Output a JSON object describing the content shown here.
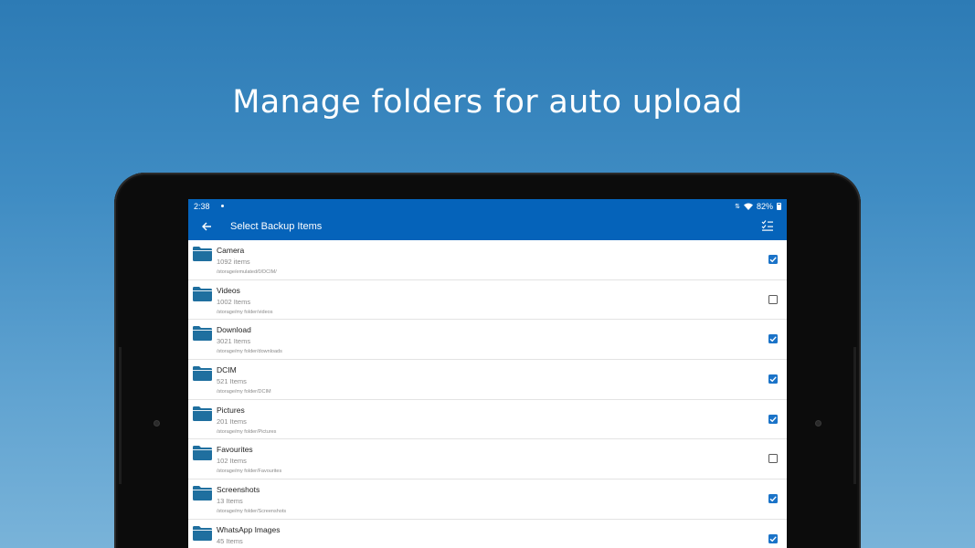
{
  "headline": "Manage folders for auto upload",
  "status_bar": {
    "time": "2:38",
    "battery": "82%"
  },
  "app_bar": {
    "title": "Select Backup Items"
  },
  "colors": {
    "primary": "#0563ba",
    "folder": "#1f6f9f",
    "checkbox_checked": "#1a73c8"
  },
  "items": [
    {
      "name": "Camera",
      "count": "1092 items",
      "path": "/storage/emulated/0/DCIM/",
      "checked": true
    },
    {
      "name": "Videos",
      "count": "1002 Items",
      "path": "/storage/my folder/videos",
      "checked": false
    },
    {
      "name": "Download",
      "count": "3021 Items",
      "path": "/storage/my folder/downloads",
      "checked": true
    },
    {
      "name": "DCIM",
      "count": "521 Items",
      "path": "/storage/my folder/DCIM",
      "checked": true
    },
    {
      "name": "Pictures",
      "count": "201 Items",
      "path": "/storage/my folder/Pictures",
      "checked": true
    },
    {
      "name": "Favourites",
      "count": "102 Items",
      "path": "/storage/my folder/Favourites",
      "checked": false
    },
    {
      "name": "Screenshots",
      "count": "13 Items",
      "path": "/storage/my folder/Screenshots",
      "checked": true
    },
    {
      "name": "WhatsApp Images",
      "count": "45 Items",
      "path": "",
      "checked": true
    }
  ]
}
